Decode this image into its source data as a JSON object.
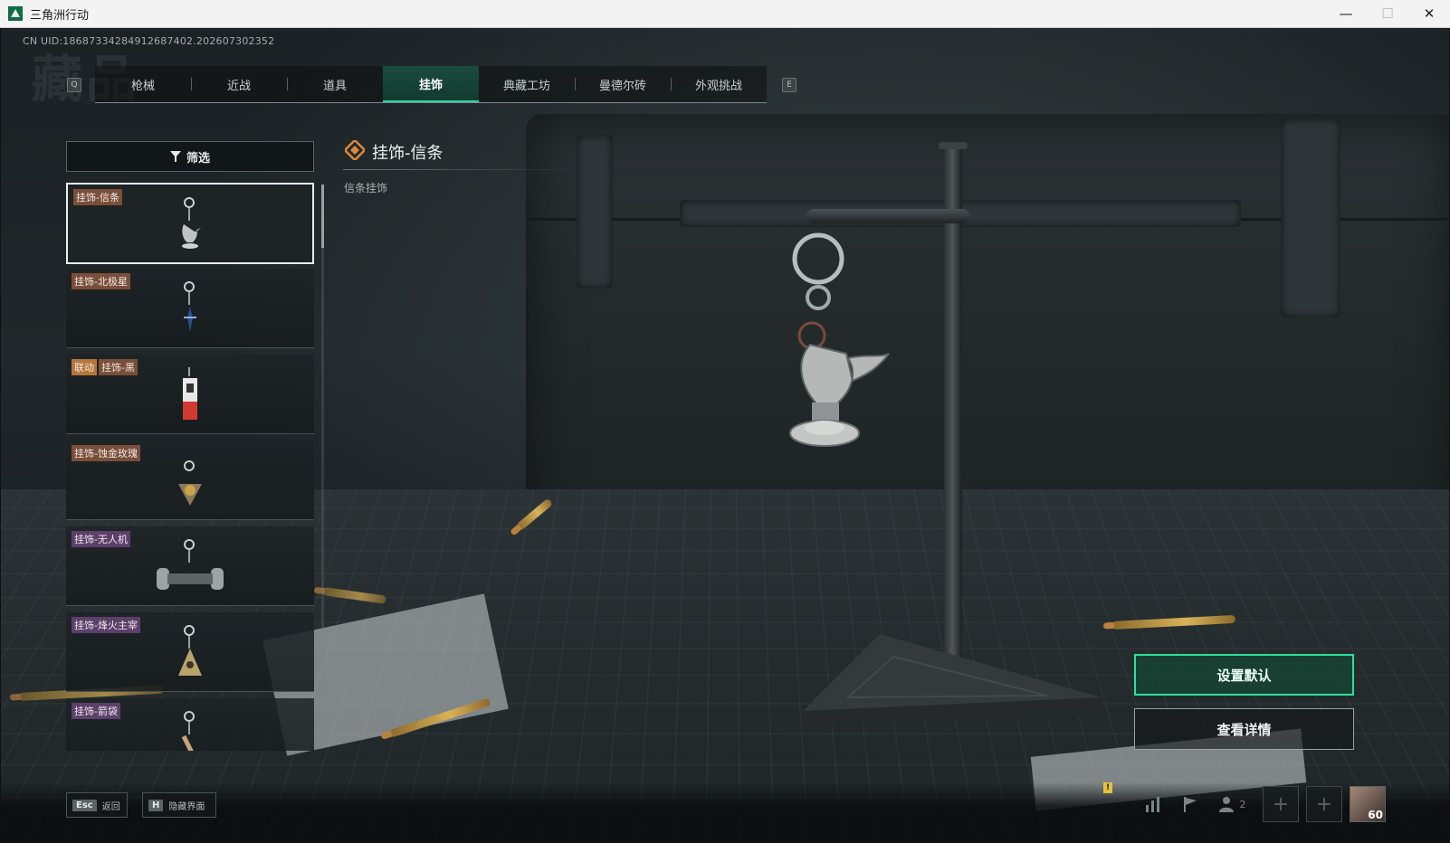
{
  "window": {
    "title": "三角洲行动",
    "minimize": "—",
    "maximize": "☐",
    "close": "✕"
  },
  "header": {
    "uid": "CN UID:18687334284912687402.202607302352",
    "watermark": "藏品",
    "key_prev": "Q",
    "key_next": "E",
    "tabs": [
      {
        "label": "枪械"
      },
      {
        "label": "近战"
      },
      {
        "label": "道具"
      },
      {
        "label": "挂饰"
      },
      {
        "label": "典藏工坊"
      },
      {
        "label": "曼德尔砖"
      },
      {
        "label": "外观挑战"
      }
    ],
    "active_tab": "挂饰"
  },
  "sidebar": {
    "filter_label": "筛选",
    "items": [
      {
        "name": "挂饰-信条",
        "selected": true
      },
      {
        "name": "挂饰-北极星"
      },
      {
        "collab": "联动",
        "name": "挂饰-黑"
      },
      {
        "name": "挂饰-蚀金玫瑰"
      },
      {
        "name": "挂饰-无人机"
      },
      {
        "name": "挂饰-烽火主宰"
      },
      {
        "name": "挂饰-箭袋"
      }
    ]
  },
  "detail": {
    "title": "挂饰-信条",
    "description": "信条挂饰"
  },
  "actions": {
    "set_default": "设置默认",
    "view_details": "查看详情"
  },
  "bottom": {
    "esc_key": "Esc",
    "esc_label": "返回",
    "h_key": "H",
    "h_label": "隐藏界面",
    "friends_count": "2",
    "player_level": "60",
    "warning_mark": "!"
  },
  "colors": {
    "accent": "#2ee09c",
    "tab_active_bg": "#1a4c3e",
    "tag_brown": "#7a4e38",
    "tag_purple": "#5c3f6a",
    "tag_collab": "#b7753a"
  }
}
